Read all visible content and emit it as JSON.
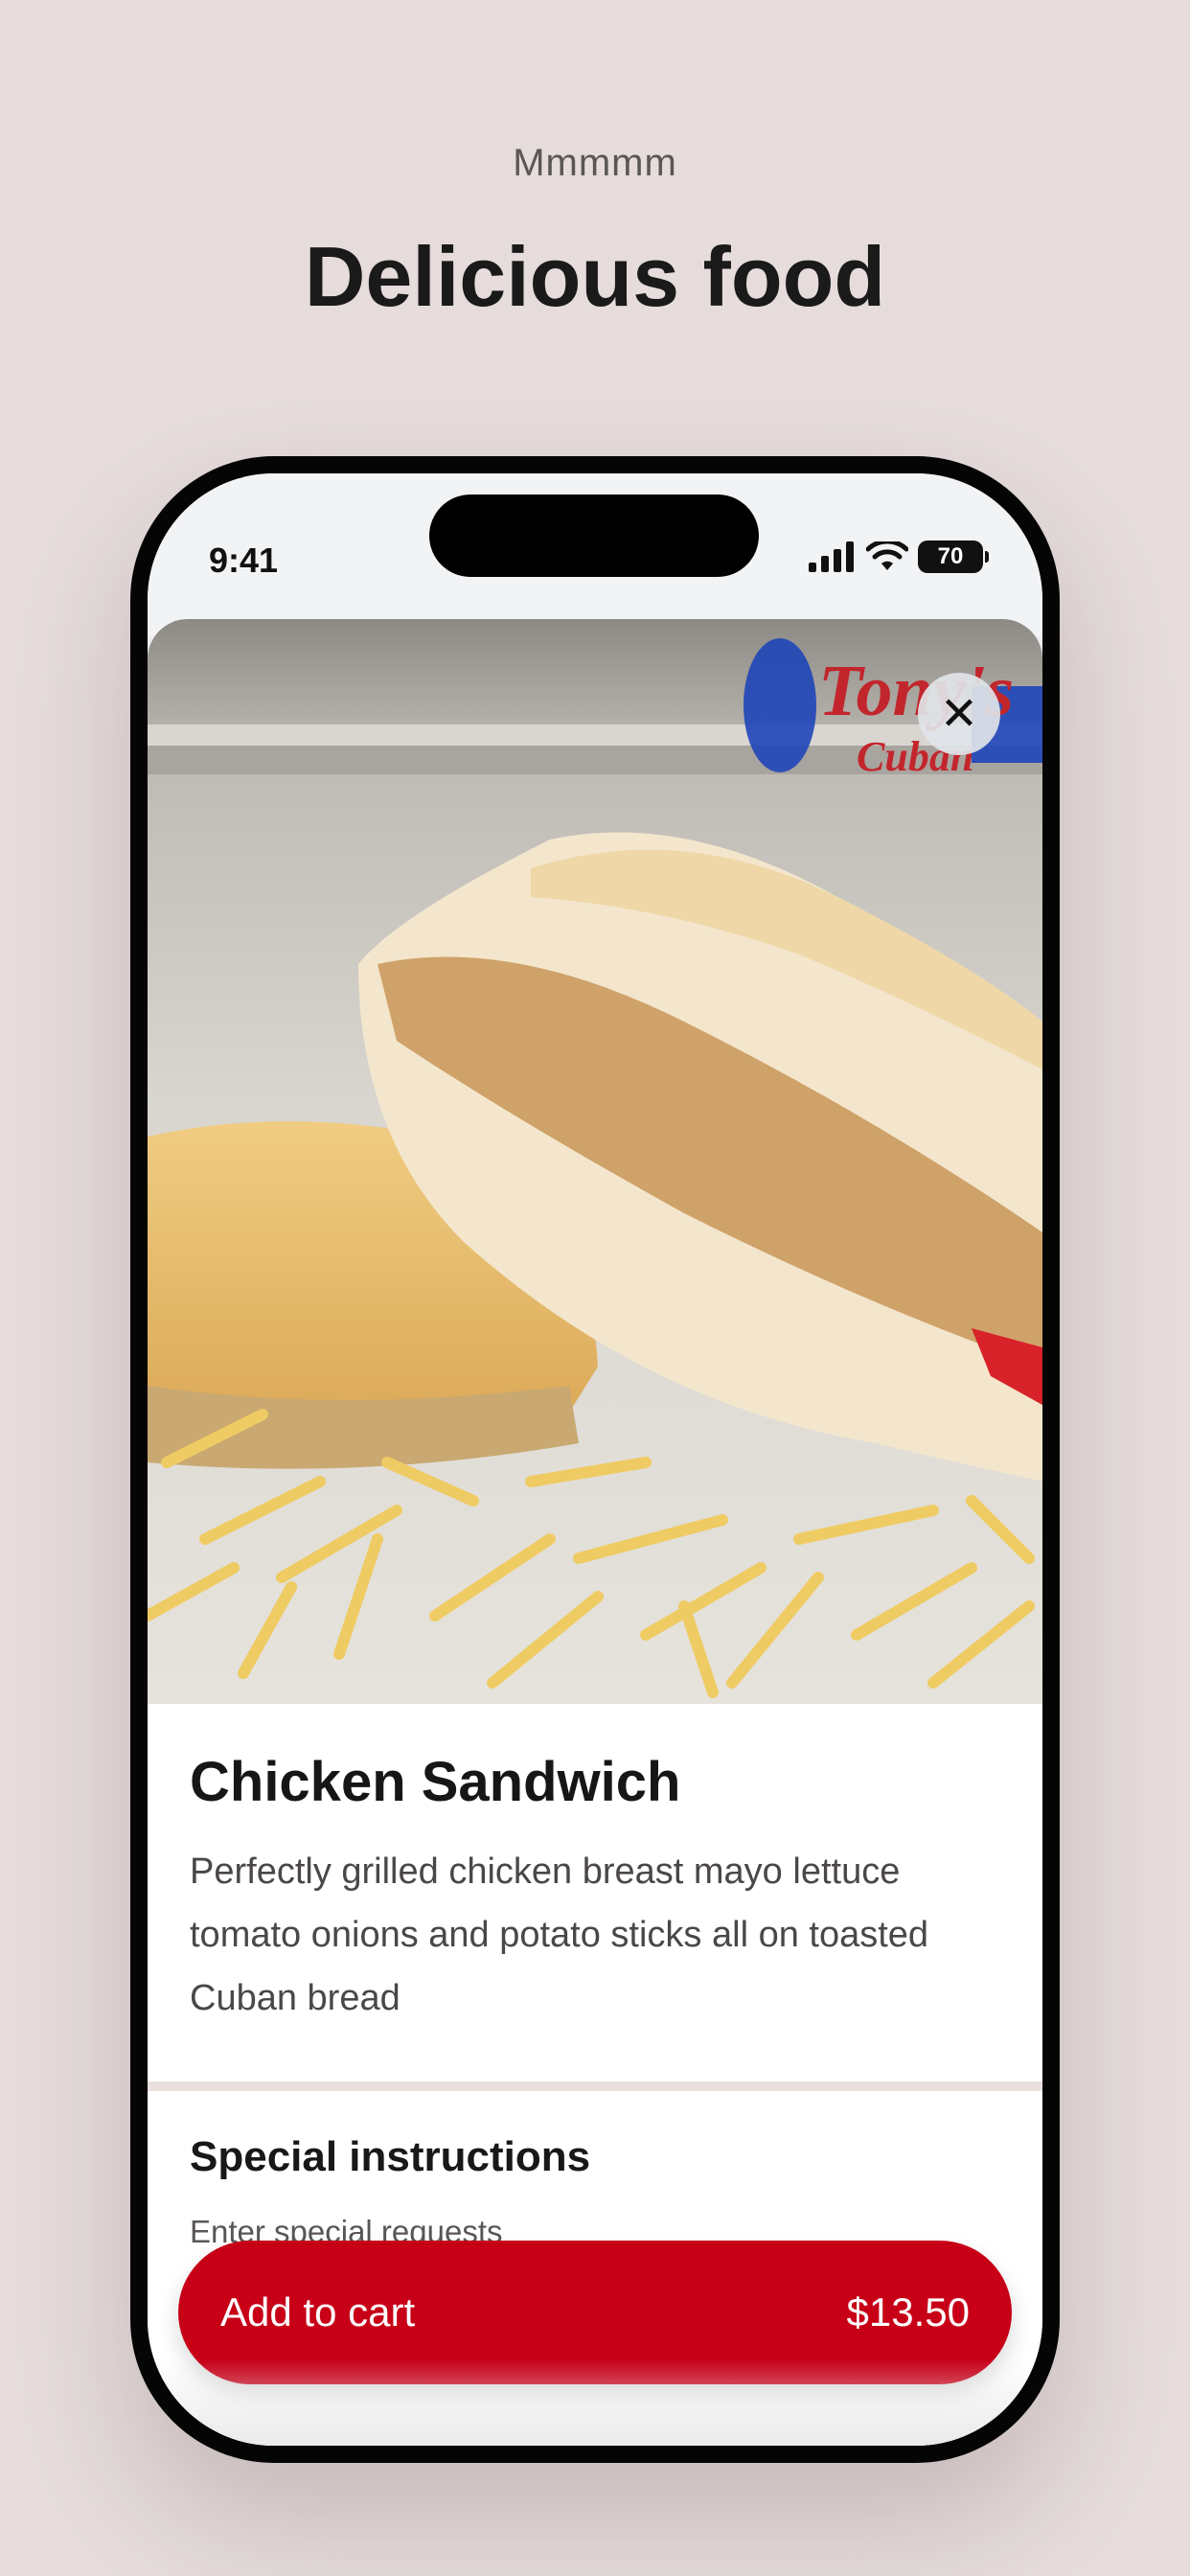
{
  "header": {
    "eyebrow": "Mmmmm",
    "title": "Delicious food"
  },
  "statusbar": {
    "time": "9:41",
    "battery": "70"
  },
  "item": {
    "name": "Chicken Sandwich",
    "description": "Perfectly grilled chicken breast mayo lettuce tomato onions and potato sticks all on toasted Cuban bread",
    "logo_text_1": "Tony's",
    "logo_text_2": "Cuban"
  },
  "special_instructions": {
    "title": "Special instructions",
    "placeholder": "Enter special requests"
  },
  "cart": {
    "label": "Add to cart",
    "price": "$13.50"
  },
  "colors": {
    "background": "#e5dcdb",
    "accent": "#c70017"
  }
}
